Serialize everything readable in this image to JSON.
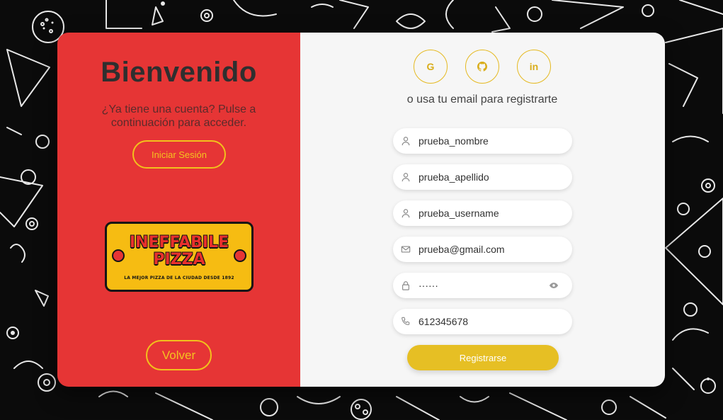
{
  "left": {
    "title": "Bienvenido",
    "subtitle": "¿Ya tiene una cuenta? Pulse a continuación para acceder.",
    "login_label": "Iniciar Sesión",
    "back_label": "Volver",
    "logo": {
      "line1": "INEFFABILE",
      "line2": "PIZZA",
      "tagline": "LA MEJOR PIZZA DE LA CIUDAD DESDE 1892"
    }
  },
  "right": {
    "socials": [
      {
        "icon": "google-icon",
        "glyph": "G"
      },
      {
        "icon": "github-icon",
        "glyph": ""
      },
      {
        "icon": "linkedin-icon",
        "glyph": "in"
      }
    ],
    "or_text": "o usa tu email para registrarte",
    "fields": {
      "nombre": {
        "value": "prueba_nombre",
        "icon": "user-icon"
      },
      "apellido": {
        "value": "prueba_apellido",
        "icon": "user-icon"
      },
      "username": {
        "value": "prueba_username",
        "icon": "user-icon"
      },
      "email": {
        "value": "prueba@gmail.com",
        "icon": "mail-icon"
      },
      "password": {
        "value": "······",
        "icon": "lock-icon",
        "toggle_icon": "eye-icon"
      },
      "phone": {
        "value": "612345678",
        "icon": "phone-icon"
      }
    },
    "submit_label": "Registrarse"
  },
  "colors": {
    "left_panel": "#e63535",
    "accent": "#e6bf24",
    "right_panel": "#f6f6f6",
    "background": "#0b0b0b"
  }
}
